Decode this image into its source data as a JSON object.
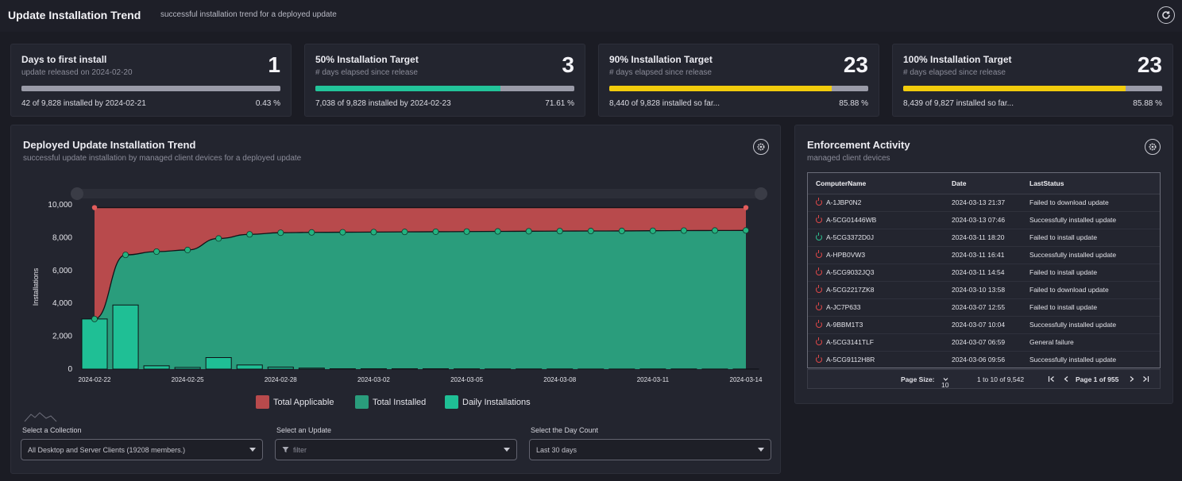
{
  "header": {
    "title": "Update Installation Trend",
    "subtitle": "successful installation trend for a deployed update"
  },
  "kpis": [
    {
      "title": "Days to first install",
      "subtitle": "update released on 2024-02-20",
      "value": "1",
      "footer": "42 of 9,828 installed by 2024-02-21",
      "percent": "0.43 %",
      "progress": 0.0043,
      "color": "#9a9ba8"
    },
    {
      "title": "50% Installation Target",
      "subtitle": "# days elapsed since release",
      "value": "3",
      "footer": "7,038 of 9,828 installed by 2024-02-23",
      "percent": "71.61 %",
      "progress": 0.7161,
      "color": "#22c49a"
    },
    {
      "title": "90% Installation Target",
      "subtitle": "# days elapsed since release",
      "value": "23",
      "footer": "8,440 of 9,828 installed so far...",
      "percent": "85.88 %",
      "progress": 0.8588,
      "color": "#f2cc0c"
    },
    {
      "title": "100% Installation Target",
      "subtitle": "# days elapsed since release",
      "value": "23",
      "footer": "8,439 of 9,827 installed so far...",
      "percent": "85.88 %",
      "progress": 0.8588,
      "color": "#f2cc0c"
    }
  ],
  "trend_panel": {
    "title": "Deployed Update Installation Trend",
    "subtitle": "successful update installation by managed client devices for a deployed update",
    "gear_icon": "gear-icon"
  },
  "chart_data": {
    "type": "area",
    "ylabel": "Installations",
    "ylim": [
      0,
      10000
    ],
    "y_ticks": [
      "10,000",
      "8,000",
      "6,000",
      "4,000",
      "2,000",
      "0"
    ],
    "x_tick_labels": [
      "2024-02-22",
      "2024-02-25",
      "2024-02-28",
      "2024-03-02",
      "2024-03-05",
      "2024-03-08",
      "2024-03-11",
      "2024-03-14"
    ],
    "x": [
      "2024-02-22",
      "2024-02-23",
      "2024-02-24",
      "2024-02-25",
      "2024-02-26",
      "2024-02-27",
      "2024-02-28",
      "2024-02-29",
      "2024-03-01",
      "2024-03-02",
      "2024-03-03",
      "2024-03-04",
      "2024-03-05",
      "2024-03-06",
      "2024-03-07",
      "2024-03-08",
      "2024-03-09",
      "2024-03-10",
      "2024-03-11",
      "2024-03-12",
      "2024-03-13",
      "2024-03-14"
    ],
    "series": [
      {
        "name": "Total Applicable",
        "color": "#b84a4c",
        "values": [
          9828,
          9828,
          9828,
          9828,
          9828,
          9828,
          9828,
          9828,
          9828,
          9828,
          9828,
          9828,
          9828,
          9828,
          9828,
          9828,
          9828,
          9828,
          9828,
          9828,
          9828,
          9828
        ]
      },
      {
        "name": "Total Installed",
        "color": "#2a9d7c",
        "values": [
          3050,
          6950,
          7150,
          7250,
          7950,
          8200,
          8300,
          8320,
          8330,
          8340,
          8350,
          8360,
          8370,
          8380,
          8390,
          8400,
          8405,
          8410,
          8420,
          8430,
          8435,
          8440
        ]
      },
      {
        "name": "Daily Installations",
        "color": "#1fbf95",
        "type": "bar",
        "values": [
          3050,
          3900,
          200,
          100,
          700,
          250,
          120,
          60,
          20,
          20,
          20,
          20,
          15,
          10,
          10,
          10,
          5,
          5,
          10,
          10,
          5,
          5
        ]
      }
    ],
    "legend": [
      "Total Applicable",
      "Total Installed",
      "Daily Installations"
    ],
    "legend_position": "bottom"
  },
  "filters": {
    "collection_label": "Select a Collection",
    "collection_value": "All Desktop and Server Clients (19208 members.)",
    "update_label": "Select an Update",
    "update_placeholder": "filter",
    "days_label": "Select the Day Count",
    "days_value": "Last 30 days"
  },
  "enforcement": {
    "title": "Enforcement Activity",
    "subtitle": "managed client devices",
    "columns": [
      "ComputerName",
      "Date",
      "LastStatus"
    ],
    "rows": [
      {
        "name": "A-1JBP0N2",
        "date": "2024-03-13 21:37",
        "status": "Failed to download update",
        "icon_color": "#e04848"
      },
      {
        "name": "A-5CG01446WB",
        "date": "2024-03-13 07:46",
        "status": "Successfully installed update",
        "icon_color": "#e04848"
      },
      {
        "name": "A-5CG3372D0J",
        "date": "2024-03-11 18:20",
        "status": "Failed to install update",
        "icon_color": "#2fbf8f"
      },
      {
        "name": "A-HPB0VW3",
        "date": "2024-03-11 16:41",
        "status": "Successfully installed update",
        "icon_color": "#e04848"
      },
      {
        "name": "A-5CG9032JQ3",
        "date": "2024-03-11 14:54",
        "status": "Failed to install update",
        "icon_color": "#e04848"
      },
      {
        "name": "A-5CG2217ZK8",
        "date": "2024-03-10 13:58",
        "status": "Failed to download update",
        "icon_color": "#e04848"
      },
      {
        "name": "A-JC7P633",
        "date": "2024-03-07 12:55",
        "status": "Failed to install update",
        "icon_color": "#e04848"
      },
      {
        "name": "A-9BBM1T3",
        "date": "2024-03-07 10:04",
        "status": "Successfully installed update",
        "icon_color": "#e04848"
      },
      {
        "name": "A-5CG3141TLF",
        "date": "2024-03-07 06:59",
        "status": "General failure",
        "icon_color": "#e04848"
      },
      {
        "name": "A-5CG9112H8R",
        "date": "2024-03-06 09:56",
        "status": "Successfully installed update",
        "icon_color": "#e04848"
      }
    ],
    "pager": {
      "page_size_label": "Page Size:",
      "page_size": "10",
      "range": "1 to 10 of 9,542",
      "page_text": "Page 1 of 955"
    }
  }
}
